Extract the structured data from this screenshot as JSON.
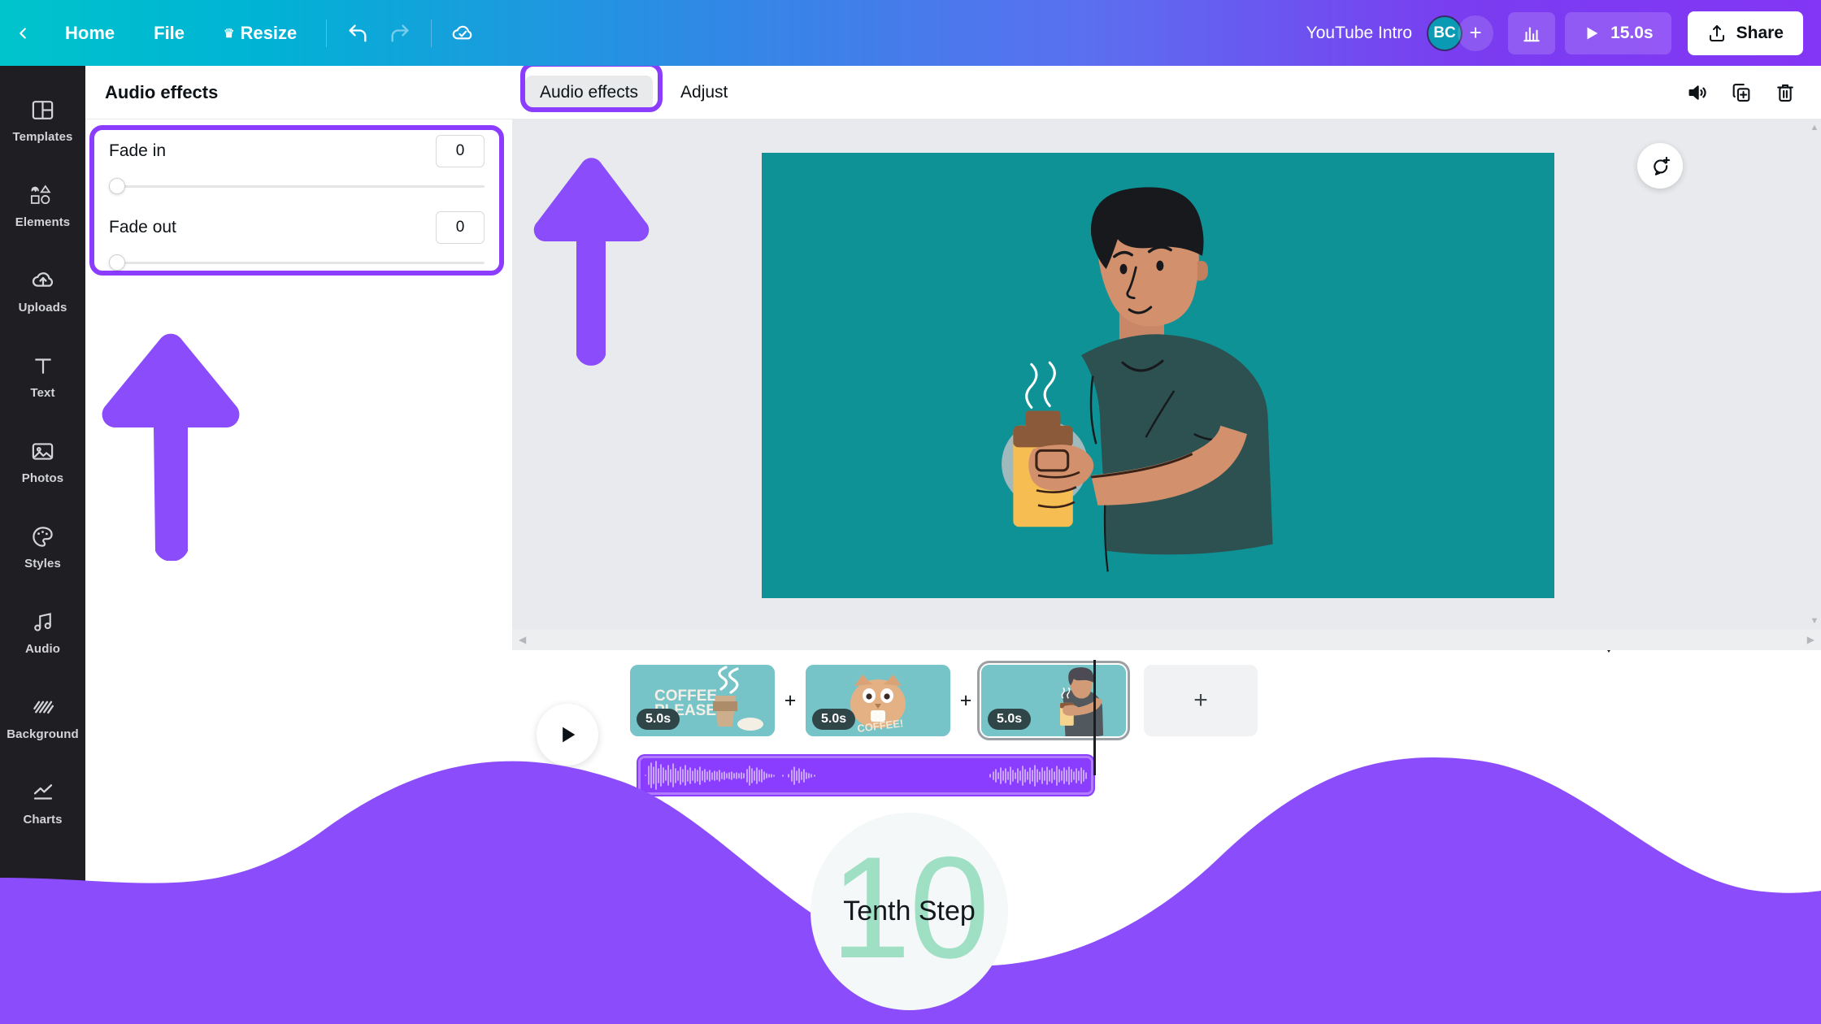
{
  "topbar": {
    "back_icon": "chevron-left-icon",
    "home_label": "Home",
    "file_label": "File",
    "resize_label": "Resize",
    "crown_icon": "crown-icon",
    "undo_icon": "undo-icon",
    "redo_icon": "redo-icon",
    "cloud_saved_icon": "cloud-check-icon",
    "doc_title": "YouTube Intro",
    "avatar_initials": "BC",
    "add_collaborator_label": "+",
    "insights_icon": "bar-chart-icon",
    "play_icon": "play-icon",
    "duration_label": "15.0s",
    "share_icon": "share-upload-icon",
    "share_label": "Share"
  },
  "rail": {
    "items": [
      {
        "label": "Templates",
        "icon": "templates-icon"
      },
      {
        "label": "Elements",
        "icon": "elements-icon"
      },
      {
        "label": "Uploads",
        "icon": "uploads-cloud-icon"
      },
      {
        "label": "Text",
        "icon": "text-icon"
      },
      {
        "label": "Photos",
        "icon": "photos-icon"
      },
      {
        "label": "Styles",
        "icon": "styles-palette-icon"
      },
      {
        "label": "Audio",
        "icon": "audio-note-icon"
      },
      {
        "label": "Background",
        "icon": "background-hatch-icon"
      },
      {
        "label": "Charts",
        "icon": "charts-line-icon"
      }
    ]
  },
  "panel": {
    "title": "Audio effects",
    "fade_in": {
      "label": "Fade in",
      "value": "0",
      "slider_percent": 0
    },
    "fade_out": {
      "label": "Fade out",
      "value": "0",
      "slider_percent": 0
    }
  },
  "context_toolbar": {
    "tabs": [
      {
        "label": "Audio effects",
        "active": true
      },
      {
        "label": "Adjust",
        "active": false
      }
    ],
    "icons": [
      {
        "name": "volume-icon"
      },
      {
        "name": "duplicate-icon"
      },
      {
        "name": "trash-icon"
      }
    ]
  },
  "canvas": {
    "background_color": "#0f9296",
    "comment_icon": "add-comment-icon",
    "scroll_up_icon": "caret-up-icon",
    "scroll_down_icon": "caret-down-icon"
  },
  "timeline": {
    "scroll_left_icon": "caret-left-icon",
    "scroll_right_icon": "caret-right-icon",
    "collapse_icon": "chevron-down-icon",
    "play_icon": "play-icon",
    "add_page_label": "+",
    "insert_label": "+",
    "clips": [
      {
        "duration": "5.0s",
        "title": "COFFEE PLEASE",
        "selected": false
      },
      {
        "duration": "5.0s",
        "title": "COFFEE!",
        "selected": false
      },
      {
        "duration": "5.0s",
        "title": "person-holding-coffee",
        "selected": true
      }
    ],
    "audio_clip": {
      "name": "audio-waveform-clip",
      "selected": true
    }
  },
  "overlay": {
    "arrow_icon": "up-arrow-annotation",
    "arrow_color": "#8b4dfb",
    "wave_color": "#8b4dfb",
    "badge": {
      "number": "10",
      "label": "Tenth Step",
      "number_color": "#9fe0c4"
    }
  }
}
